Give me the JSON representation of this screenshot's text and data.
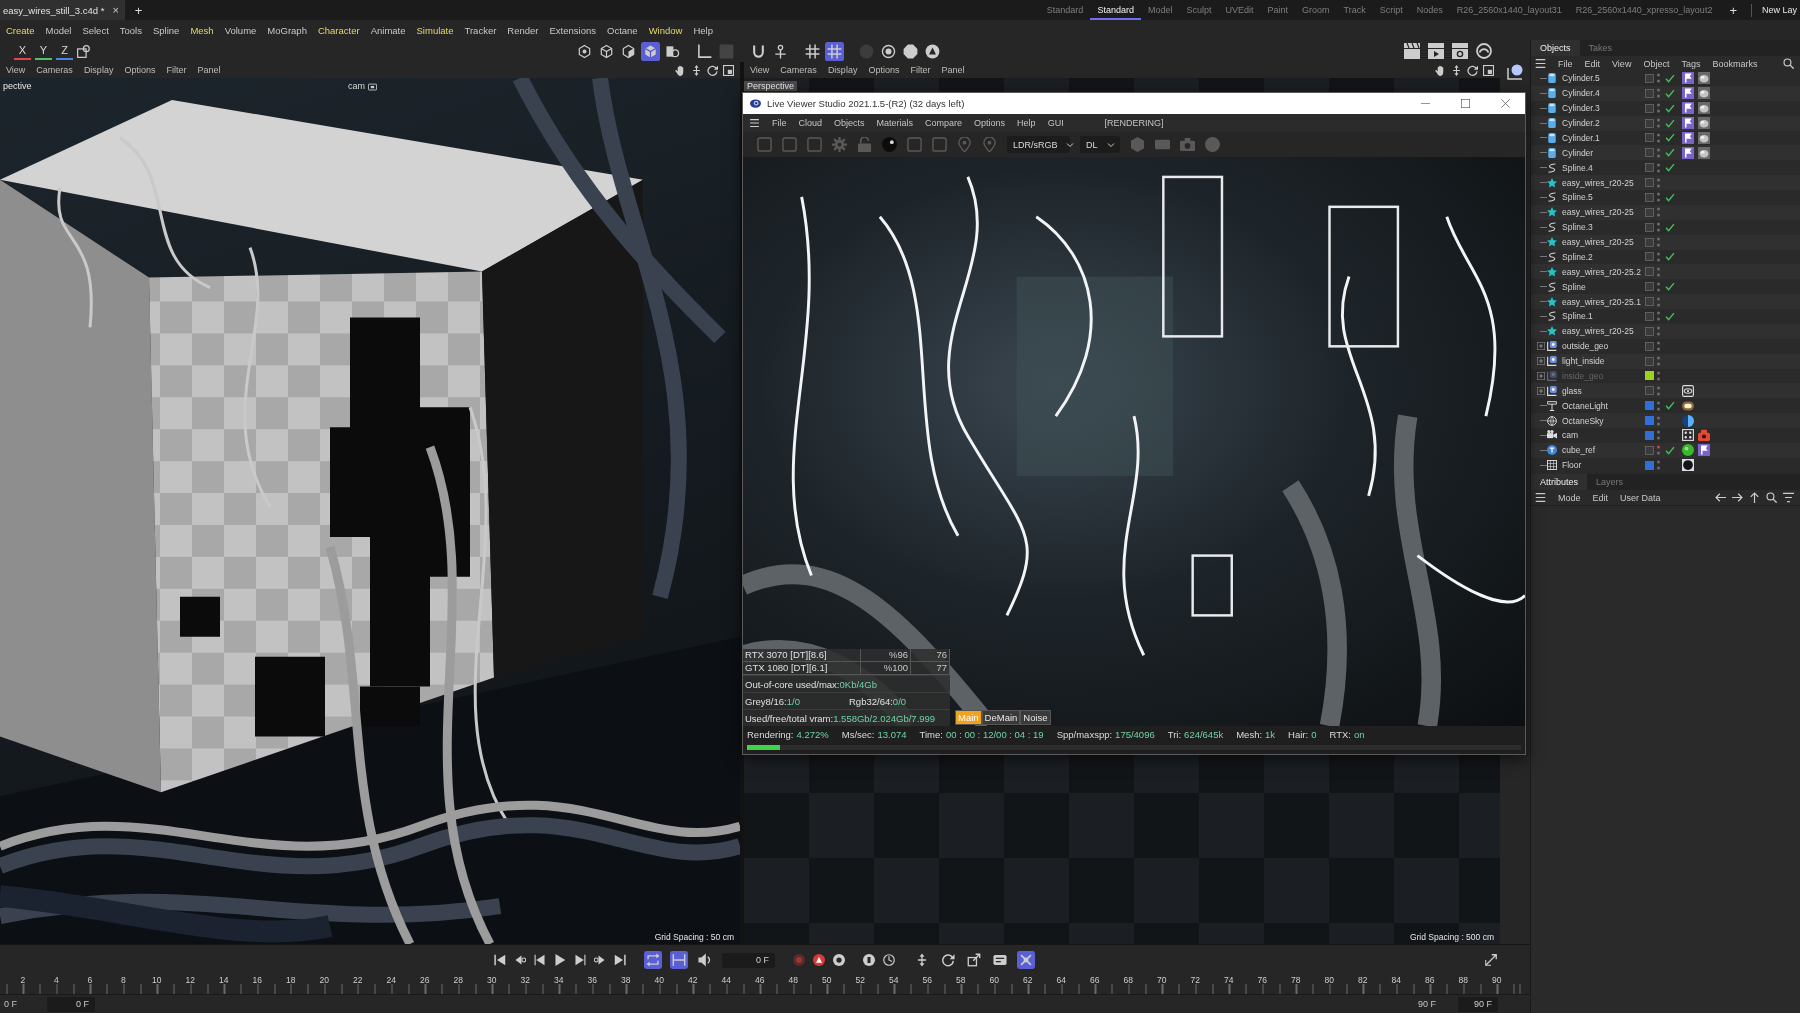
{
  "document_tab": {
    "title": "easy_wires_still_3.c4d *",
    "close": "×",
    "add": "+"
  },
  "layouts": {
    "tabs": [
      {
        "label": "Standard",
        "selected": false
      },
      {
        "label": "Standard",
        "selected": true
      },
      {
        "label": "Model",
        "selected": false
      },
      {
        "label": "Sculpt",
        "selected": false
      },
      {
        "label": "UVEdit",
        "selected": false
      },
      {
        "label": "Paint",
        "selected": false
      },
      {
        "label": "Groom",
        "selected": false
      },
      {
        "label": "Track",
        "selected": false
      },
      {
        "label": "Script",
        "selected": false
      },
      {
        "label": "Nodes",
        "selected": false
      },
      {
        "label": "R26_2560x1440_layout31",
        "selected": false
      },
      {
        "label": "R26_2560x1440_xpresso_layout2",
        "selected": false
      }
    ],
    "add": "+",
    "new_layout": "New Lay"
  },
  "menu_bar": [
    {
      "label": "Create",
      "highlighted": true
    },
    {
      "label": "Model",
      "highlighted": false
    },
    {
      "label": "Select",
      "highlighted": false
    },
    {
      "label": "Tools",
      "highlighted": false
    },
    {
      "label": "Spline",
      "highlighted": false
    },
    {
      "label": "Mesh",
      "highlighted": true
    },
    {
      "label": "Volume",
      "highlighted": false
    },
    {
      "label": "MoGraph",
      "highlighted": false
    },
    {
      "label": "Character",
      "highlighted": true
    },
    {
      "label": "Animate",
      "highlighted": false
    },
    {
      "label": "Simulate",
      "highlighted": true
    },
    {
      "label": "Tracker",
      "highlighted": false
    },
    {
      "label": "Render",
      "highlighted": false
    },
    {
      "label": "Extensions",
      "highlighted": false
    },
    {
      "label": "Octane",
      "highlighted": false
    },
    {
      "label": "Window",
      "highlighted": true
    },
    {
      "label": "Help",
      "highlighted": false
    }
  ],
  "toolbar": {
    "axes": [
      {
        "label": "X",
        "color": "#e0474c"
      },
      {
        "label": "Y",
        "color": "#4cc26a"
      },
      {
        "label": "Z",
        "color": "#4a86e0"
      }
    ],
    "tools": [
      {
        "kind": "points",
        "on": false
      },
      {
        "kind": "edges",
        "on": false
      },
      {
        "kind": "polys",
        "on": false
      },
      {
        "kind": "model",
        "on": true
      },
      {
        "kind": "texture",
        "on": false
      },
      {
        "kind": "axis",
        "on": false
      },
      {
        "kind": "solo",
        "on": false
      },
      {
        "kind": "magnet",
        "on": false
      },
      {
        "kind": "snap",
        "on": false
      },
      {
        "kind": "grid",
        "on": false
      },
      {
        "kind": "workplane",
        "on": true
      },
      {
        "kind": "disc",
        "on": false
      },
      {
        "kind": "target",
        "on": false
      },
      {
        "kind": "stop",
        "on": false
      },
      {
        "kind": "badge",
        "on": false
      }
    ]
  },
  "viewport_left": {
    "menu": [
      "View",
      "Cameras",
      "Display",
      "Options",
      "Filter",
      "Panel"
    ],
    "label": "pective",
    "camera_label": "cam",
    "grid_spacing": "Grid Spacing : 50 cm"
  },
  "viewport_right": {
    "menu": [
      "View",
      "Cameras",
      "Display",
      "Options",
      "Filter",
      "Panel"
    ],
    "label": "Perspective",
    "grid_spacing": "Grid Spacing : 500 cm"
  },
  "live_viewer": {
    "title": "Live Viewer Studio 2021.1.5-(R2) (32 days left)",
    "menu": [
      "File",
      "Cloud",
      "Objects",
      "Materials",
      "Compare",
      "Options",
      "Help",
      "GUI"
    ],
    "state": "[RENDERING]",
    "dropdowns": [
      "LDR/sRGB",
      "DL"
    ],
    "gpus": [
      {
        "name": "RTX 3070 [DT][8.6]",
        "usage": "%96",
        "temperature": "76"
      },
      {
        "name": "GTX 1080 [DT][6.1]",
        "usage": "%100",
        "temperature": "77"
      }
    ],
    "stats": [
      [
        {
          "label": "Out-of-core used/max:",
          "value": "0Kb/4Gb"
        }
      ],
      [
        {
          "label": "Grey8/16:",
          "value": "1/0"
        },
        {
          "label": "Rgb32/64:",
          "value": "0/0"
        }
      ],
      [
        {
          "label": "Used/free/total vram:",
          "value": "1.558Gb/2.024Gb/7.999"
        }
      ]
    ],
    "passes": [
      {
        "label": "Main",
        "selected": true
      },
      {
        "label": "DeMain",
        "selected": false
      },
      {
        "label": "Noise",
        "selected": false
      }
    ],
    "status_line": [
      {
        "label": "Rendering:",
        "value": "4.272%"
      },
      {
        "label": "Ms/sec:",
        "value": "13.074"
      },
      {
        "label": "Time:",
        "value": "00 : 00 : 12/00 : 04 : 19"
      },
      {
        "label": "Spp/maxspp:",
        "value": "175/4096"
      },
      {
        "label": "Tri:",
        "value": "624/645k"
      },
      {
        "label": "Mesh:",
        "value": "1k"
      },
      {
        "label": "Hair:",
        "value": "0"
      },
      {
        "label": "RTX:",
        "value": "on"
      }
    ],
    "progress": {
      "level": 0.043
    }
  },
  "objects_panel": {
    "tabs": [
      {
        "label": "Objects",
        "selected": true
      },
      {
        "label": "Takes",
        "selected": false
      }
    ],
    "menu": [
      "File",
      "Edit",
      "View",
      "Object",
      "Tags",
      "Bookmarks"
    ],
    "objects": [
      {
        "name": "Cylinder.5",
        "kind": "cylinder",
        "collapsed": false,
        "dimmed": false,
        "hidden": false,
        "enabled": true,
        "tags": [
          {
            "kind": "phong"
          },
          {
            "kind": "material"
          }
        ]
      },
      {
        "name": "Cylinder.4",
        "kind": "cylinder",
        "collapsed": false,
        "dimmed": false,
        "hidden": false,
        "enabled": true,
        "tags": [
          {
            "kind": "phong"
          },
          {
            "kind": "material"
          }
        ]
      },
      {
        "name": "Cylinder.3",
        "kind": "cylinder",
        "collapsed": false,
        "dimmed": false,
        "hidden": false,
        "enabled": true,
        "tags": [
          {
            "kind": "phong"
          },
          {
            "kind": "material"
          }
        ]
      },
      {
        "name": "Cylinder.2",
        "kind": "cylinder",
        "collapsed": false,
        "dimmed": false,
        "hidden": false,
        "enabled": true,
        "tags": [
          {
            "kind": "phong"
          },
          {
            "kind": "material"
          }
        ]
      },
      {
        "name": "Cylinder.1",
        "kind": "cylinder",
        "collapsed": false,
        "dimmed": false,
        "hidden": false,
        "enabled": true,
        "tags": [
          {
            "kind": "phong"
          },
          {
            "kind": "material"
          }
        ]
      },
      {
        "name": "Cylinder",
        "kind": "cylinder",
        "collapsed": false,
        "dimmed": false,
        "hidden": false,
        "enabled": true,
        "tags": [
          {
            "kind": "phong"
          },
          {
            "kind": "material"
          }
        ]
      },
      {
        "name": "Spline.4",
        "kind": "spline",
        "collapsed": false,
        "dimmed": false,
        "hidden": false,
        "enabled": true
      },
      {
        "name": "easy_wires_r20-25",
        "kind": "generator",
        "collapsed": false,
        "dimmed": false,
        "hidden": false,
        "enabled": false
      },
      {
        "name": "Spline.5",
        "kind": "spline",
        "collapsed": false,
        "dimmed": false,
        "hidden": false,
        "enabled": true
      },
      {
        "name": "easy_wires_r20-25",
        "kind": "generator",
        "collapsed": false,
        "dimmed": false,
        "hidden": false,
        "enabled": false
      },
      {
        "name": "Spline.3",
        "kind": "spline",
        "collapsed": false,
        "dimmed": false,
        "hidden": false,
        "enabled": true
      },
      {
        "name": "easy_wires_r20-25",
        "kind": "generator",
        "collapsed": false,
        "dimmed": false,
        "hidden": false,
        "enabled": false
      },
      {
        "name": "Spline.2",
        "kind": "spline",
        "collapsed": false,
        "dimmed": false,
        "hidden": false,
        "enabled": true
      },
      {
        "name": "easy_wires_r20-25.2",
        "kind": "generator",
        "collapsed": false,
        "dimmed": false,
        "hidden": false,
        "enabled": false
      },
      {
        "name": "Spline",
        "kind": "spline",
        "collapsed": false,
        "dimmed": false,
        "hidden": false,
        "enabled": true
      },
      {
        "name": "easy_wires_r20-25.1",
        "kind": "generator",
        "collapsed": false,
        "dimmed": false,
        "hidden": false,
        "enabled": false
      },
      {
        "name": "Spline.1",
        "kind": "spline",
        "collapsed": false,
        "dimmed": false,
        "hidden": false,
        "enabled": true
      },
      {
        "name": "easy_wires_r20-25",
        "kind": "generator",
        "collapsed": false,
        "dimmed": false,
        "hidden": false,
        "enabled": false
      },
      {
        "name": "outside_geo",
        "kind": "group",
        "collapsed": true,
        "dimmed": false,
        "hidden": false,
        "enabled": false
      },
      {
        "name": "light_inside",
        "kind": "group",
        "collapsed": true,
        "dimmed": false,
        "hidden": false,
        "enabled": false
      },
      {
        "name": "inside_geo",
        "kind": "group",
        "collapsed": true,
        "dimmed": true,
        "hidden": false,
        "enabled": false,
        "color": "#9ad21c"
      },
      {
        "name": "glass",
        "kind": "group",
        "collapsed": true,
        "dimmed": false,
        "hidden": false,
        "enabled": false,
        "tags": [
          {
            "kind": "display"
          }
        ]
      },
      {
        "name": "OctaneLight",
        "kind": "light",
        "collapsed": false,
        "dimmed": false,
        "hidden": false,
        "enabled": true,
        "color": "#2f6fd6",
        "tags": [
          {
            "kind": "light"
          }
        ]
      },
      {
        "name": "OctaneSky",
        "kind": "sky",
        "collapsed": false,
        "dimmed": false,
        "hidden": false,
        "enabled": false,
        "color": "#2f6fd6",
        "tags": [
          {
            "kind": "sky"
          }
        ]
      },
      {
        "name": "cam",
        "kind": "camera",
        "collapsed": false,
        "dimmed": false,
        "hidden": false,
        "enabled": false,
        "color": "#2f6fd6",
        "tags": [
          {
            "kind": "target"
          },
          {
            "kind": "camera"
          }
        ]
      },
      {
        "name": "cube_ref",
        "kind": "primitive",
        "collapsed": false,
        "dimmed": false,
        "hidden": true,
        "enabled": true,
        "tags": [
          {
            "kind": "material-green"
          },
          {
            "kind": "phong"
          }
        ]
      },
      {
        "name": "Floor",
        "kind": "floor",
        "collapsed": false,
        "dimmed": false,
        "hidden": false,
        "enabled": false,
        "color": "#2f6fd6",
        "tags": [
          {
            "kind": "material-dark"
          }
        ]
      }
    ]
  },
  "attributes_panel": {
    "tabs": [
      {
        "label": "Attributes",
        "selected": true
      },
      {
        "label": "Layers",
        "selected": false
      }
    ],
    "menu": [
      "Mode",
      "Edit",
      "User Data"
    ]
  },
  "timeline": {
    "modes": [
      {
        "kind": "loop",
        "on": true
      },
      {
        "kind": "range",
        "on": true
      },
      {
        "kind": "sound",
        "on": false
      }
    ],
    "frame_field": "0 F",
    "key_tools": [
      {
        "kind": "move",
        "on": false
      },
      {
        "kind": "rotate",
        "on": false
      },
      {
        "kind": "scale",
        "on": false
      },
      {
        "kind": "param",
        "on": false
      },
      {
        "kind": "pla",
        "on": true
      }
    ],
    "ruler": [
      "2",
      "4",
      "6",
      "8",
      "10",
      "12",
      "14",
      "16",
      "18",
      "20",
      "22",
      "24",
      "26",
      "28",
      "30",
      "32",
      "34",
      "36",
      "38",
      "40",
      "42",
      "44",
      "46",
      "48",
      "50",
      "52",
      "54",
      "56",
      "58",
      "60",
      "62",
      "64",
      "66",
      "68",
      "70",
      "72",
      "74",
      "76",
      "78",
      "80",
      "82",
      "84",
      "86",
      "88",
      "90"
    ],
    "start_label": "0 F",
    "start_field": "0 F",
    "end_label": "90 F",
    "end_field": "90 F"
  }
}
